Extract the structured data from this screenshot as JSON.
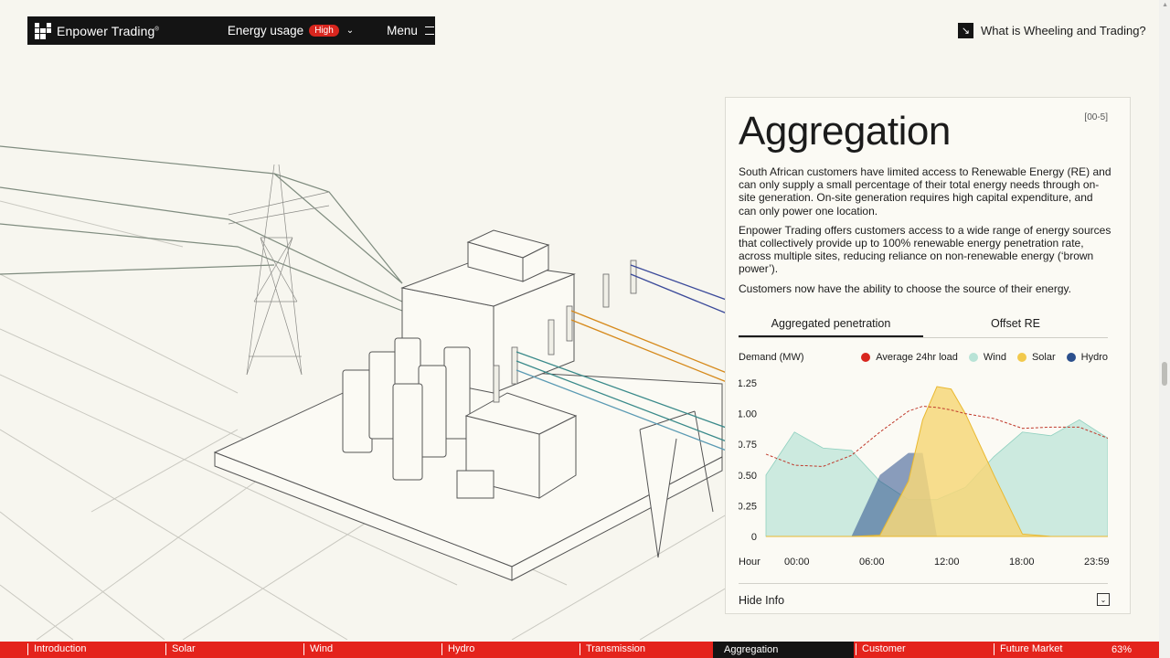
{
  "brand": {
    "name": "Enpower Trading",
    "mark": "®"
  },
  "topbar": {
    "energy_label": "Energy usage",
    "energy_badge": "High",
    "menu_label": "Menu"
  },
  "whatis": {
    "label": "What is Wheeling and Trading?"
  },
  "panel": {
    "title": "Aggregation",
    "index": "[00-5]",
    "paragraphs": [
      "South African customers have limited access to Renewable Energy (RE) and can only supply a small percentage of their total energy needs through on-site generation. On-site generation requires high capital expenditure, and can only power one location.",
      "Enpower Trading offers customers access to a wide range of energy sources that collectively provide up to 100% renewable energy penetration rate, across multiple sites, reducing reliance on non-renewable energy (‘brown power’).",
      "Customers now have the ability to choose the source of their energy."
    ],
    "tabs": [
      "Aggregated penetration",
      "Offset RE"
    ],
    "hide_label": "Hide Info"
  },
  "chart_data": {
    "type": "area",
    "ylabel": "Demand (MW)",
    "xlabel": "Hour",
    "ylim": [
      0,
      1.25
    ],
    "yticks": [
      "1.25",
      "1.00",
      "0.75",
      "0.50",
      "0.25",
      "0"
    ],
    "xticks": [
      "00:00",
      "06:00",
      "12:00",
      "18:00",
      "23:59"
    ],
    "x": [
      0,
      2,
      4,
      6,
      8,
      10,
      11,
      12,
      13,
      14,
      16,
      18,
      20,
      22,
      24
    ],
    "legend": [
      {
        "name": "Average 24hr load",
        "color": "#d8261e"
      },
      {
        "name": "Wind",
        "color": "#b8e3d6"
      },
      {
        "name": "Solar",
        "color": "#f2c94c"
      },
      {
        "name": "Hydro",
        "color": "#2b4f8c"
      }
    ],
    "series": [
      {
        "name": "Average 24hr load",
        "values": [
          0.67,
          0.58,
          0.57,
          0.66,
          0.85,
          1.02,
          1.06,
          1.05,
          1.03,
          1.0,
          0.96,
          0.88,
          0.89,
          0.89,
          0.8
        ]
      },
      {
        "name": "Wind",
        "values": [
          0.5,
          0.85,
          0.72,
          0.7,
          0.45,
          0.3,
          0.3,
          0.3,
          0.35,
          0.4,
          0.65,
          0.85,
          0.82,
          0.95,
          0.8
        ]
      },
      {
        "name": "Solar",
        "values": [
          0,
          0,
          0,
          0,
          0.01,
          0.45,
          0.95,
          1.22,
          1.2,
          1.0,
          0.5,
          0.02,
          0,
          0,
          0
        ]
      },
      {
        "name": "Hydro",
        "values": [
          0,
          0,
          0,
          0,
          0.5,
          0.68,
          0.68,
          0,
          0,
          0,
          0,
          0,
          0,
          0,
          0
        ]
      }
    ]
  },
  "nav": {
    "items": [
      "Introduction",
      "Solar",
      "Wind",
      "Hydro",
      "Transmission",
      "Aggregation",
      "Customer",
      "Future Market"
    ],
    "active": "Aggregation",
    "progress": "63%"
  }
}
